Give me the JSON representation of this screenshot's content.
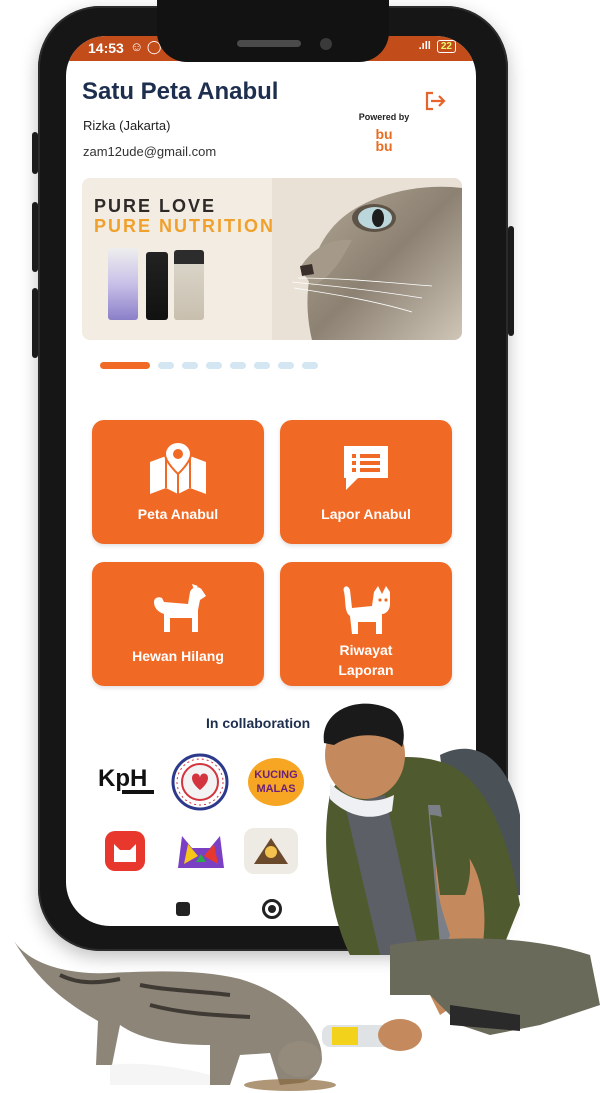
{
  "status_bar": {
    "time": "14:53",
    "signal": ".ıll",
    "battery": "22"
  },
  "header": {
    "app_title": "Satu Peta Anabul",
    "user_name": "Rizka (Jakarta)",
    "user_email": "zam12ude@gmail.com",
    "powered_by": "Powered by",
    "partner_logo_text": [
      "bu",
      "bu"
    ]
  },
  "banner": {
    "line1": "PURE LOVE",
    "line2": "PURE NUTRITION",
    "dot_count": 8,
    "active_dot": 0
  },
  "menu": [
    {
      "label": "Peta Anabul",
      "icon": "map-pin-icon"
    },
    {
      "label": "Lapor Anabul",
      "icon": "report-chat-icon"
    },
    {
      "label": "Hewan Hilang",
      "icon": "dog-icon"
    },
    {
      "label": "Riwayat Laporan",
      "icon": "cat-icon"
    }
  ],
  "collaboration": {
    "heading": "In collaboration",
    "kph_logo_text": "KpH",
    "kucing_logo_text": "KUCING MALAS"
  },
  "colors": {
    "accent": "#f06a25",
    "status_bar": "#c24d1b",
    "title": "#1e2e4e"
  }
}
